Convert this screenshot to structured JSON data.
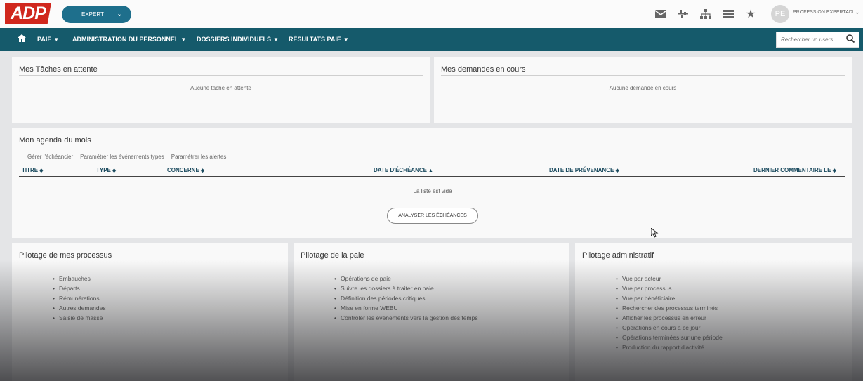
{
  "header": {
    "logo": "ADP",
    "role": "EXPERT",
    "user_initials": "PE",
    "user_name": "PROFESSION EXPERTADP",
    "icons": [
      "mail-icon",
      "org-chart-icon",
      "hierarchy-icon",
      "list-icon",
      "star-icon"
    ]
  },
  "nav": {
    "items": [
      {
        "label": "PAIE"
      },
      {
        "label": "ADMINISTRATION DU PERSONNEL"
      },
      {
        "label": "DOSSIERS INDIVIDUELS"
      },
      {
        "label": "RÉSULTATS PAIE"
      }
    ],
    "search_placeholder": "Rechercher un users"
  },
  "tasks_panel": {
    "title": "Mes Tâches en attente",
    "empty": "Aucune tâche en attente"
  },
  "requests_panel": {
    "title": "Mes demandes en cours",
    "empty": "Aucune demande en cours"
  },
  "agenda": {
    "title": "Mon agenda du mois",
    "links": [
      "Gérer l'échéancier",
      "Paramétrer les événements types",
      "Paramétrer les alertes"
    ],
    "columns": [
      "TITRE",
      "TYPE",
      "CONCERNE",
      "DATE D'ÉCHÉANCE",
      "DATE DE PRÉVENANCE",
      "DERNIER COMMENTAIRE LE"
    ],
    "sort_icons": [
      "◆",
      "◆",
      "◆",
      "▲",
      "◆",
      "◆"
    ],
    "empty": "La liste est vide",
    "button": "ANALYSER LES ÉCHÉANCES"
  },
  "process_panel": {
    "title": "Pilotage de mes processus",
    "items": [
      "Embauches",
      "Départs",
      "Rémunérations",
      "Autres demandes",
      "Saisie de masse"
    ]
  },
  "payroll_panel": {
    "title": "Pilotage de la paie",
    "items": [
      "Opérations de paie",
      "Suivre les dossiers à traiter en paie",
      "Définition des périodes critiques",
      "Mise en forme WEBU",
      "Contrôler les événements vers la gestion des temps"
    ]
  },
  "admin_panel": {
    "title": "Pilotage administratif",
    "items": [
      "Vue par acteur",
      "Vue par processus",
      "Vue par bénéficiaire",
      "Rechercher des processus terminés",
      "Afficher les processus en erreur",
      "Opérations en cours à ce jour",
      "Opérations terminées sur une période",
      "Production du rapport d'activité"
    ]
  }
}
